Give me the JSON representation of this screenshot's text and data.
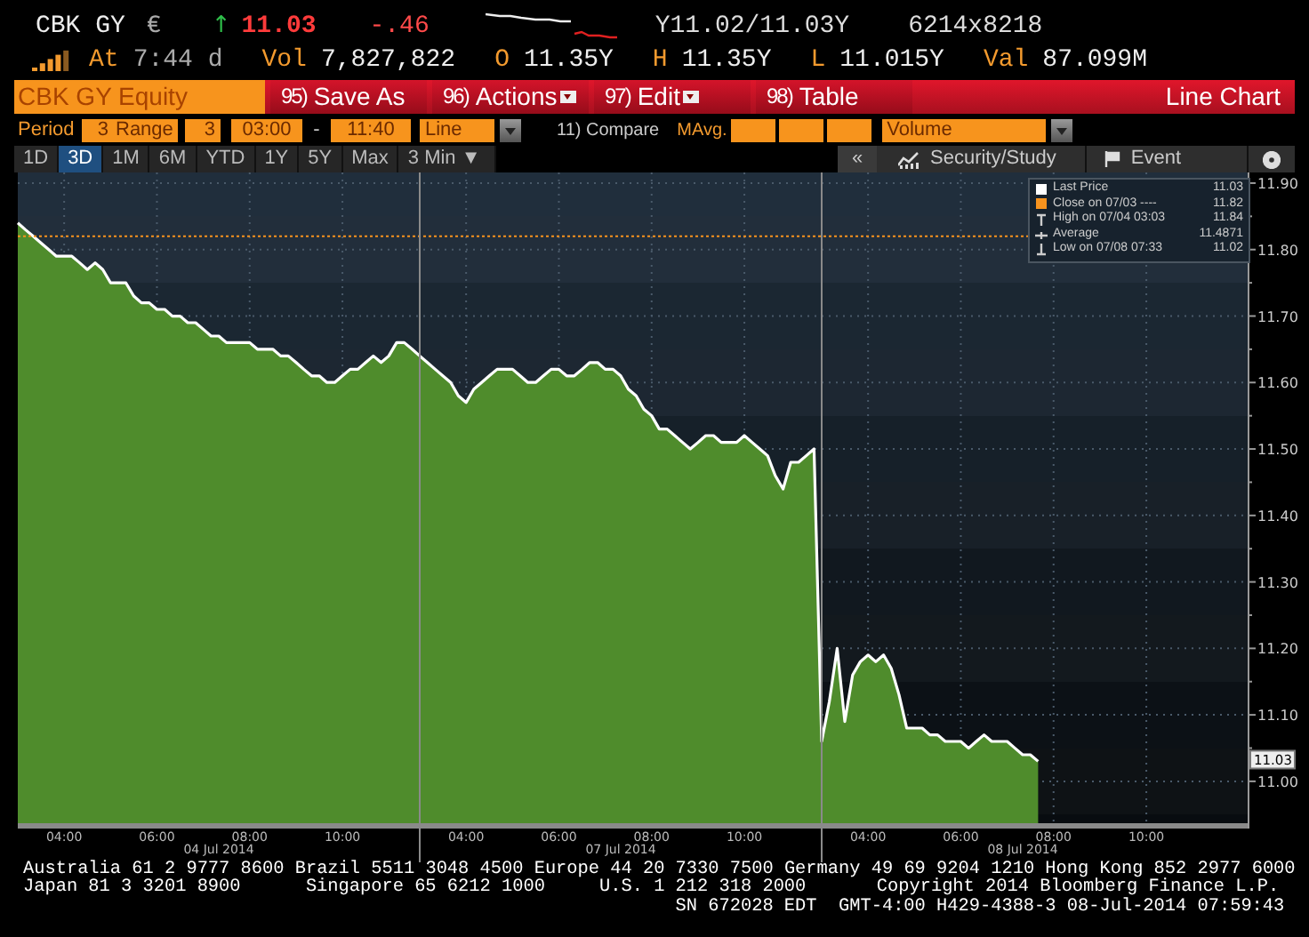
{
  "quote": {
    "ticker": "CBK GY",
    "currency": "€",
    "arrow": "↑",
    "last": "11.03",
    "change": "-.46",
    "bid_ask": "Y11.02/11.03Y",
    "size": "6214x8218"
  },
  "stats": [
    {
      "label": "At",
      "value": "7:44 d"
    },
    {
      "label": "Vol",
      "value": "7,827,822"
    },
    {
      "label": "O",
      "value": "11.35Y"
    },
    {
      "label": "H",
      "value": "11.35Y"
    },
    {
      "label": "L",
      "value": "11.015Y"
    },
    {
      "label": "Val",
      "value": "87.099M"
    }
  ],
  "toolbar": {
    "security": "CBK GY Equity",
    "buttons": [
      {
        "number": "95)",
        "label": "Save As",
        "dropdown": false
      },
      {
        "number": "96)",
        "label": "Actions",
        "dropdown": true
      },
      {
        "number": "97)",
        "label": "Edit",
        "dropdown": true
      },
      {
        "number": "98)",
        "label": "Table",
        "dropdown": false
      }
    ],
    "view": "Line Chart"
  },
  "settings": {
    "period_label": "Period",
    "period": "3",
    "range_label": "Range",
    "range": "3",
    "start": "03:00",
    "separator": "-",
    "end": "11:40",
    "style": "Line",
    "compare": "11) Compare",
    "mavg_label": "MAvg.",
    "lower_chart": "Volume"
  },
  "ranges": [
    {
      "label": "1D",
      "selected": false
    },
    {
      "label": "3D",
      "selected": true
    },
    {
      "label": "1M",
      "selected": false
    },
    {
      "label": "6M",
      "selected": false
    },
    {
      "label": "YTD",
      "selected": false
    },
    {
      "label": "1Y",
      "selected": false
    },
    {
      "label": "5Y",
      "selected": false
    },
    {
      "label": "Max",
      "selected": false
    }
  ],
  "frequency": {
    "label": "3 Min",
    "caret": "▼"
  },
  "chart_tools": {
    "collapse": "«",
    "security_study": "Security/Study",
    "event": "Event"
  },
  "legend": [
    {
      "kind": "last",
      "label": "Last Price",
      "value": "11.03"
    },
    {
      "kind": "close",
      "label": "Close on 07/03 ----",
      "value": "11.82"
    },
    {
      "kind": "high",
      "label": "High on 07/04 03:03",
      "value": "11.84"
    },
    {
      "kind": "average",
      "label": "Average",
      "value": "11.4871"
    },
    {
      "kind": "low",
      "label": "Low on 07/08 07:33",
      "value": "11.02"
    }
  ],
  "chart": {
    "chart_data": {
      "type": "area",
      "categories": [
        null,
        null,
        null,
        null,
        null,
        null,
        "04:00",
        null,
        null,
        null,
        null,
        null,
        null,
        null,
        null,
        null,
        null,
        null,
        "06:00",
        null,
        null,
        null,
        null,
        null,
        null,
        null,
        null,
        null,
        null,
        null,
        "08:00",
        null,
        null,
        null,
        null,
        null,
        null,
        null,
        null,
        null,
        null,
        null,
        "10:00",
        null,
        null,
        null,
        null,
        null,
        null,
        null,
        null,
        null,
        null,
        null,
        null,
        null,
        null,
        null,
        "04:00",
        null,
        null,
        null,
        null,
        null,
        null,
        null,
        null,
        null,
        null,
        null,
        "06:00",
        null,
        null,
        null,
        null,
        null,
        null,
        null,
        null,
        null,
        null,
        null,
        "08:00",
        null,
        null,
        null,
        null,
        null,
        null,
        null,
        null,
        null,
        null,
        null,
        "10:00",
        null,
        null,
        null,
        null,
        null,
        null,
        null,
        null,
        null,
        null,
        null,
        null,
        null,
        null,
        null,
        "04:00",
        null,
        null,
        null,
        null,
        null,
        null,
        null,
        null,
        null,
        null,
        null,
        "06:00",
        null,
        null,
        null,
        null,
        null,
        null,
        null,
        null,
        null,
        null,
        null,
        "08:00",
        null,
        null,
        null,
        null,
        null,
        null,
        null,
        null,
        null,
        null,
        null,
        "10:00",
        null,
        null,
        null,
        null,
        null,
        null,
        null,
        null,
        null
      ],
      "series": [
        {
          "color": "#4f8c2c",
          "values": [
            11.84,
            11.83,
            11.82,
            11.81,
            11.8,
            11.79,
            11.79,
            11.79,
            11.78,
            11.77,
            11.78,
            11.77,
            11.75,
            11.75,
            11.75,
            11.73,
            11.72,
            11.72,
            11.71,
            11.71,
            11.7,
            11.7,
            11.69,
            11.69,
            11.68,
            11.67,
            11.67,
            11.66,
            11.66,
            11.66,
            11.66,
            11.65,
            11.65,
            11.65,
            11.64,
            11.64,
            11.63,
            11.62,
            11.61,
            11.61,
            11.6,
            11.6,
            11.61,
            11.62,
            11.62,
            11.63,
            11.64,
            11.63,
            11.64,
            11.66,
            11.66,
            11.65,
            11.64,
            11.63,
            11.62,
            11.61,
            11.6,
            11.58,
            11.57,
            11.59,
            11.6,
            11.61,
            11.62,
            11.62,
            11.62,
            11.61,
            11.6,
            11.6,
            11.61,
            11.62,
            11.62,
            11.61,
            11.61,
            11.62,
            11.63,
            11.63,
            11.62,
            11.62,
            11.61,
            11.59,
            11.58,
            11.56,
            11.55,
            11.53,
            11.53,
            11.52,
            11.51,
            11.5,
            11.51,
            11.52,
            11.52,
            11.51,
            11.51,
            11.51,
            11.52,
            11.51,
            11.5,
            11.49,
            11.46,
            11.44,
            11.48,
            11.48,
            11.49,
            11.5,
            11.06,
            11.12,
            11.2,
            11.09,
            11.16,
            11.18,
            11.19,
            11.18,
            11.19,
            11.17,
            11.13,
            11.08,
            11.08,
            11.08,
            11.07,
            11.07,
            11.06,
            11.06,
            11.06,
            11.05,
            11.06,
            11.07,
            11.06,
            11.06,
            11.06,
            11.05,
            11.04,
            11.04,
            11.03,
            null,
            null,
            null,
            null,
            null,
            null,
            null,
            null,
            null,
            null,
            null,
            null,
            null,
            null,
            null,
            null,
            null,
            null,
            null,
            null,
            null,
            null,
            null
          ]
        }
      ],
      "ylim": [
        10.937,
        11.916
      ],
      "yticks": [
        {
          "value": 11.0,
          "label": "11.00"
        },
        {
          "value": 11.1,
          "label": "11.10"
        },
        {
          "value": 11.2,
          "label": "11.20"
        },
        {
          "value": 11.3,
          "label": "11.30"
        },
        {
          "value": 11.4,
          "label": "11.40"
        },
        {
          "value": 11.5,
          "label": "11.50"
        },
        {
          "value": 11.6,
          "label": "11.60"
        },
        {
          "value": 11.7,
          "label": "11.70"
        },
        {
          "value": 11.8,
          "label": "11.80"
        },
        {
          "value": 11.9,
          "label": "11.90"
        }
      ],
      "grid": true,
      "ref_lines": [
        {
          "axis": "y",
          "value": 11.82
        }
      ]
    },
    "price_tag": "11.03",
    "session_dates": [
      "04 Jul 2014",
      "07 Jul 2014",
      "08 Jul 2014"
    ]
  },
  "footer": {
    "line_1": "Australia 61 2 9777 8600 Brazil 5511 3048 4500 Europe 44 20 7330 7500 Germany 49 69 9204 1210 Hong Kong 852 2977 6000",
    "line_2": [
      "Japan 81 3 3201 8900",
      "Singapore 65 6212 1000",
      "U.S. 1 212 318 2000",
      "Copyright 2014 Bloomberg Finance L.P."
    ],
    "line_3": "SN 672028 EDT  GMT-4:00 H429-4388-3 08-Jul-2014 07:59:43"
  }
}
